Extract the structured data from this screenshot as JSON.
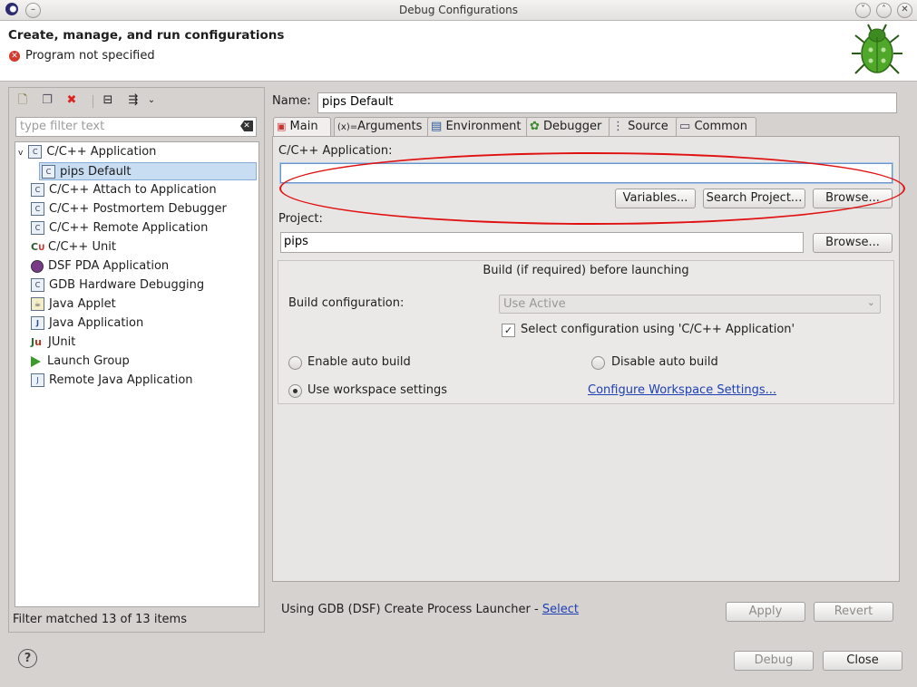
{
  "window": {
    "title": "Debug Configurations"
  },
  "header": {
    "title": "Create, manage, and run configurations",
    "message": "Program not specified"
  },
  "left": {
    "filter_placeholder": "type filter text",
    "tree": [
      {
        "label": "C/C++ Application",
        "icon": "c-icon",
        "expanded": true
      },
      {
        "label": "pips Default",
        "icon": "c-icon",
        "selected": true,
        "child": true
      },
      {
        "label": "C/C++ Attach to Application",
        "icon": "c-icon"
      },
      {
        "label": "C/C++ Postmortem Debugger",
        "icon": "c-icon"
      },
      {
        "label": "C/C++ Remote Application",
        "icon": "c-icon"
      },
      {
        "label": "C/C++ Unit",
        "icon": "cu-icon"
      },
      {
        "label": "DSF PDA Application",
        "icon": "pda-icon"
      },
      {
        "label": "GDB Hardware Debugging",
        "icon": "c-icon"
      },
      {
        "label": "Java Applet",
        "icon": "applet-icon"
      },
      {
        "label": "Java Application",
        "icon": "j-icon"
      },
      {
        "label": "JUnit",
        "icon": "ju-icon"
      },
      {
        "label": "Launch Group",
        "icon": "launch-icon"
      },
      {
        "label": "Remote Java Application",
        "icon": "remote-icon"
      }
    ],
    "status": "Filter matched 13 of 13 items"
  },
  "config": {
    "name_label": "Name:",
    "name_value": "pips Default",
    "tabs": [
      "Main",
      "Arguments",
      "Environment",
      "Debugger",
      "Source",
      "Common"
    ],
    "app_label": "C/C++ Application:",
    "app_value": "",
    "variables_btn": "Variables...",
    "search_btn": "Search Project...",
    "browse_btn": "Browse...",
    "project_label": "Project:",
    "project_value": "pips",
    "project_browse_btn": "Browse...",
    "build": {
      "title": "Build (if required) before launching",
      "config_label": "Build configuration:",
      "config_value": "Use Active",
      "select_config_label": "Select configuration using 'C/C++ Application'",
      "enable_auto": "Enable auto build",
      "disable_auto": "Disable auto build",
      "use_workspace": "Use workspace settings",
      "configure_link": "Configure Workspace Settings..."
    },
    "launcher_text": "Using GDB (DSF) Create Process Launcher - ",
    "launcher_link": "Select",
    "apply_btn": "Apply",
    "revert_btn": "Revert"
  },
  "footer": {
    "debug_btn": "Debug",
    "close_btn": "Close"
  }
}
